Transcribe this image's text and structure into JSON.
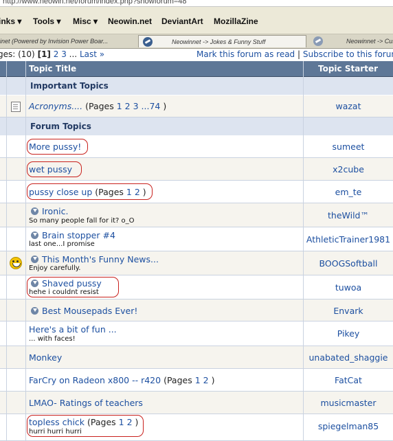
{
  "browser": {
    "url": "http://www.neowin.net/forum/index.php?showforum=48",
    "bookmarks": [
      "inks ▾",
      "Tools ▾",
      "Misc ▾",
      "Neowin.net",
      "DeviantArt",
      "MozillaZine"
    ],
    "tabs": [
      "inet (Powered by Invision Power Boar...",
      "Neowinnet -> Jokes & Funny Stuff",
      "Neowinnet -> Cus"
    ]
  },
  "pager": {
    "prefix": "ges: (10)",
    "current": "[1]",
    "p2": "2",
    "p3": "3",
    "sep": "...",
    "last": "Last »",
    "mark_read": "Mark this forum as read",
    "divider": "|",
    "subscribe": "Subscribe to this forum"
  },
  "header": {
    "title": "Topic Title",
    "starter": "Topic Starter"
  },
  "sections": {
    "important": "Important Topics",
    "forum": "Forum Topics"
  },
  "important": {
    "title": "Acronyms....",
    "pages_open": "(Pages",
    "pages": "1 2 3 ...74",
    "pages_close": ")",
    "starter": "wazat"
  },
  "topics": [
    {
      "title": "More pussy!",
      "starter": "sumeet"
    },
    {
      "title": "wet pussy",
      "starter": "x2cube"
    },
    {
      "title": "pussy close up",
      "pages_open": "(Pages",
      "pages": "1 2",
      "pages_close": ")",
      "starter": "em_te"
    },
    {
      "title": "Ironic.",
      "desc": "So many people fall for it? o_O",
      "starter": "theWild™"
    },
    {
      "title": "Brain stopper #4",
      "desc": "last one...I promise",
      "starter": "AthleticTrainer1981"
    },
    {
      "title": "This Month's Funny News...",
      "desc": "Enjoy carefully.",
      "starter": "BOOGSoftball"
    },
    {
      "title": "Shaved pussy",
      "desc": "hehe i couldnt resist",
      "starter": "tuwoa"
    },
    {
      "title": "Best Mousepads Ever!",
      "starter": "Envark"
    },
    {
      "title": "Here's a bit of fun ...",
      "desc": "... with faces!",
      "starter": "Pikey"
    },
    {
      "title": "Monkey",
      "starter": "unabated_shaggie"
    },
    {
      "title": "FarCry on Radeon x800 -- r420",
      "pages_open": "(Pages",
      "pages": "1 2",
      "pages_close": ")",
      "starter": "FatCat"
    },
    {
      "title": "LMAO- Ratings of teachers",
      "starter": "musicmaster"
    },
    {
      "title": "topless chick",
      "pages_open": "(Pages",
      "pages": "1 2",
      "pages_close": ")",
      "desc": "hurri hurri hurri",
      "starter": "spiegelman85"
    }
  ]
}
